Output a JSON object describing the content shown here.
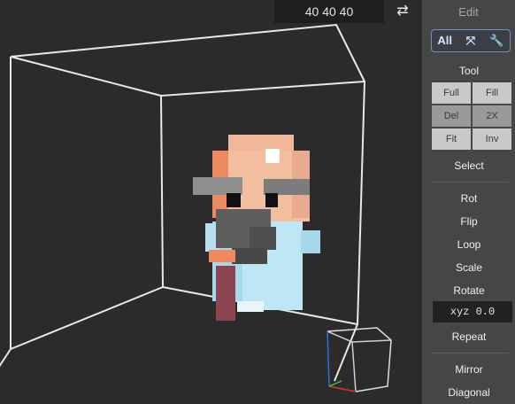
{
  "viewport": {
    "size_label": "40  40  40",
    "swap_icon": "⇄"
  },
  "panel": {
    "title": "Edit",
    "modes": {
      "all_label": "All",
      "expand_icon": "⤧",
      "wrench_icon": "🔧"
    },
    "tool_heading": "Tool",
    "tools": [
      "Full",
      "Fill",
      "Del",
      "2X",
      "Fit",
      "Inv"
    ],
    "select_label": "Select",
    "actions": [
      "Rot",
      "Flip",
      "Loop",
      "Scale",
      "Rotate"
    ],
    "xyz_value": "xyz 0.0",
    "repeat_label": "Repeat",
    "mirror_label": "Mirror",
    "diagonal_label": "Diagonal"
  },
  "colors": {
    "accent": "#6a8fc0",
    "panel_bg": "#464646",
    "viewport_bg": "#2b2b2b"
  }
}
